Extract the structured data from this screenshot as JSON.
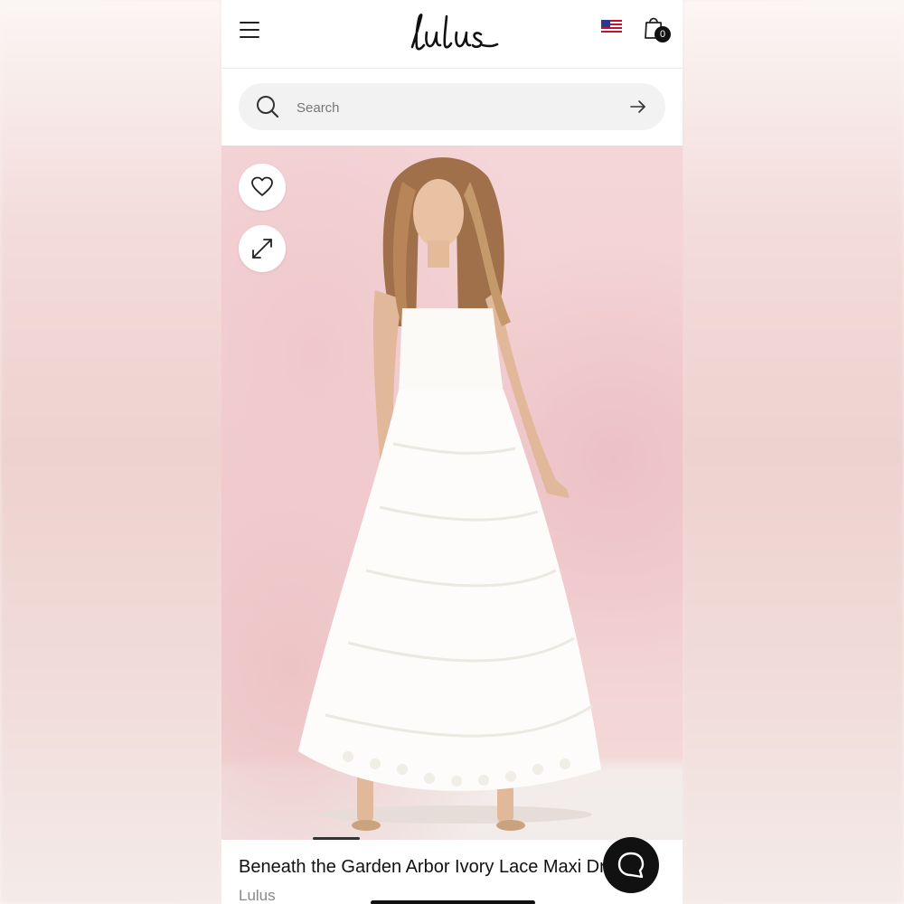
{
  "header": {
    "logo_text": "Lulus",
    "cart_count": "0",
    "menu_icon": "hamburger-menu-icon",
    "flag_icon": "us-flag-icon",
    "cart_icon": "shopping-bag-icon"
  },
  "search": {
    "placeholder": "Search",
    "value": ""
  },
  "product": {
    "title": "Beneath the Garden Arbor Ivory Lace Maxi Dress",
    "brand": "Lulus",
    "image_slide_active": 1
  },
  "actions": {
    "wishlist_icon": "heart-icon",
    "expand_icon": "expand-icon",
    "chat_icon": "chat-bubble-icon"
  },
  "colors": {
    "accent": "#111111",
    "background_pink": "#f2cfd1"
  }
}
